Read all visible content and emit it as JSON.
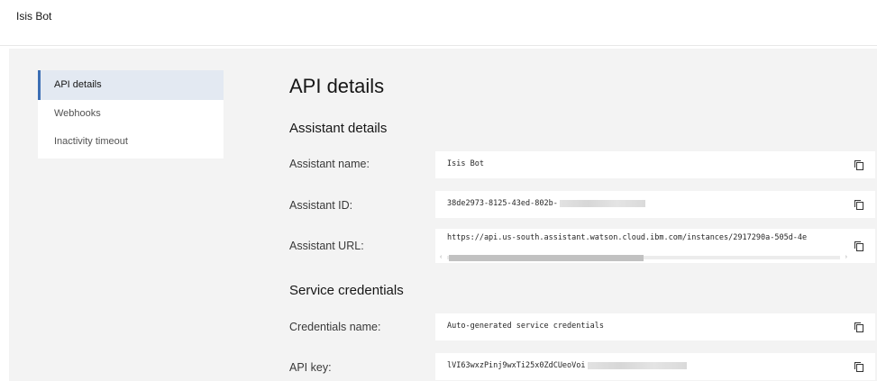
{
  "app": {
    "title": "Isis Bot"
  },
  "nav": {
    "items": [
      {
        "label": "API details",
        "active": true
      },
      {
        "label": "Webhooks",
        "active": false
      },
      {
        "label": "Inactivity timeout",
        "active": false
      }
    ]
  },
  "main": {
    "title": "API details",
    "assistant_section": {
      "title": "Assistant details",
      "fields": [
        {
          "label": "Assistant name:",
          "value": "Isis Bot"
        },
        {
          "label": "Assistant ID:",
          "value": "38de2973-8125-43ed-802b-"
        },
        {
          "label": "Assistant URL:",
          "value": "https://api.us-south.assistant.watson.cloud.ibm.com/instances/2917290a-505d-4e"
        }
      ]
    },
    "credentials_section": {
      "title": "Service credentials",
      "fields": [
        {
          "label": "Credentials name:",
          "value": "Auto-generated service credentials"
        },
        {
          "label": "API key:",
          "value": "lVI63wxzPinj9wxTi25x0ZdCUeoVoi"
        }
      ]
    }
  },
  "icons": {
    "copy": "copy-icon"
  },
  "colors": {
    "accent": "#3c6fb4",
    "active_bg": "#e3e9f2",
    "panel_bg": "#f3f3f3"
  }
}
